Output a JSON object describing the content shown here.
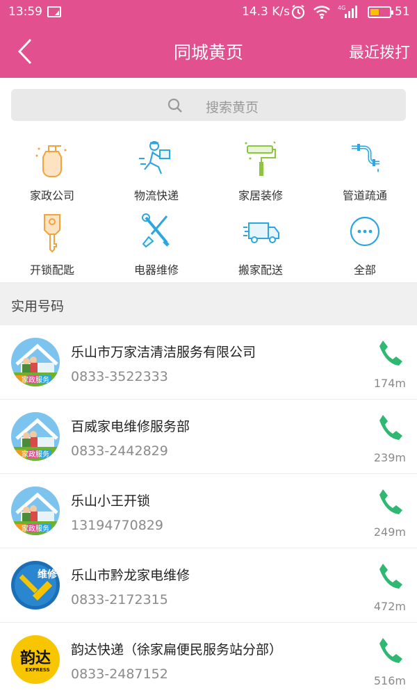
{
  "status": {
    "time": "13:59",
    "speed": "14.3 K/s",
    "network": "4G",
    "battery": "51"
  },
  "header": {
    "back_icon": "chevron-left-icon",
    "title": "同城黄页",
    "right_action": "最近拨打"
  },
  "search": {
    "placeholder": "搜索黄页",
    "icon": "search-icon"
  },
  "categories": [
    {
      "label": "家政公司",
      "icon": "spray-bottle-icon"
    },
    {
      "label": "物流快递",
      "icon": "courier-runner-icon"
    },
    {
      "label": "家居装修",
      "icon": "paint-roller-icon"
    },
    {
      "label": "管道疏通",
      "icon": "pipe-icon"
    },
    {
      "label": "开锁配匙",
      "icon": "key-icon"
    },
    {
      "label": "电器维修",
      "icon": "tools-icon"
    },
    {
      "label": "搬家配送",
      "icon": "truck-icon"
    },
    {
      "label": "全部",
      "icon": "more-icon"
    }
  ],
  "section": {
    "title": "实用号码"
  },
  "listings": [
    {
      "name": "乐山市万家洁清洁服务有限公司",
      "phone": "0833-3522333",
      "distance": "174m",
      "avatar": "housekeeping-avatar",
      "avatar_text": "家政服务"
    },
    {
      "name": "百威家电维修服务部",
      "phone": "0833-2442829",
      "distance": "239m",
      "avatar": "housekeeping-avatar",
      "avatar_text": "家政服务"
    },
    {
      "name": "乐山小王开锁",
      "phone": "13194770829",
      "distance": "249m",
      "avatar": "housekeeping-avatar",
      "avatar_text": "家政服务"
    },
    {
      "name": "乐山市黔龙家电维修",
      "phone": "0833-2172315",
      "distance": "472m",
      "avatar": "repair-avatar",
      "avatar_text": "维修"
    },
    {
      "name": "韵达快递（徐家扁便民服务站分部）",
      "phone": "0833-2487152",
      "distance": "516m",
      "avatar": "yunda-logo",
      "avatar_text": "韵达",
      "avatar_sub": "EXPRESS"
    }
  ],
  "colors": {
    "brand": "#e2508f",
    "icon_blue": "#2ba6e0",
    "icon_orange": "#f2a33a",
    "icon_green": "#8cc63f",
    "call_green": "#2eb872"
  }
}
